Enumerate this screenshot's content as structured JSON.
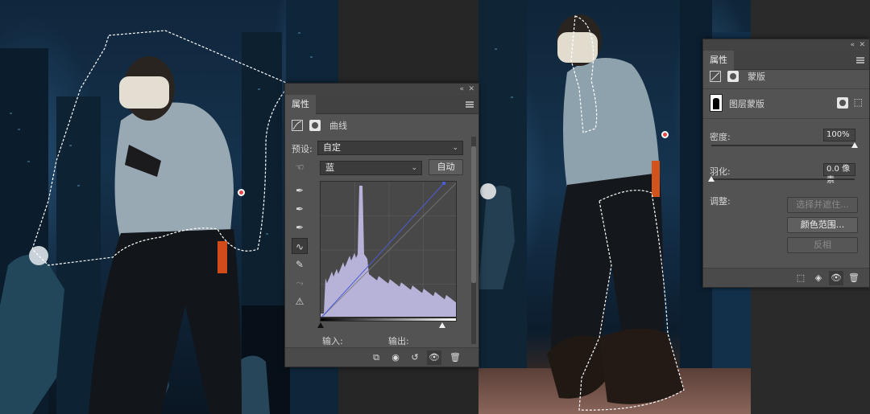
{
  "curves_panel": {
    "tab_label": "属性",
    "title_label": "曲线",
    "preset_label": "预设:",
    "preset_value": "自定",
    "channel_value": "蓝",
    "auto_button": "自动",
    "input_label": "输入:",
    "output_label": "输出:",
    "icons": {
      "adjustment_type": "curves-adjustment-icon",
      "mask": "layer-mask-icon",
      "target_adjust": "target-adjust-hand-icon",
      "black_point": "black-point-eyedropper-icon",
      "gray_point": "gray-point-eyedropper-icon",
      "white_point": "white-point-eyedropper-icon",
      "curve_point": "curve-point-tool-icon",
      "pencil": "pencil-draw-icon",
      "smooth": "smooth-curve-icon",
      "clipping_warning": "clipping-warning-icon",
      "clip_to_layer": "clip-to-layer-icon",
      "view_previous": "view-previous-state-icon",
      "reset": "reset-icon",
      "visibility": "eye-icon",
      "delete": "trash-icon"
    }
  },
  "mask_panel": {
    "tab_label": "属性",
    "title_label": "蒙版",
    "layer_mask_label": "图层蒙版",
    "density_label": "密度:",
    "density_value": "100%",
    "feather_label": "羽化:",
    "feather_value": "0.0 像素",
    "refine_label": "调整:",
    "select_and_mask_button": "选择并遮住...",
    "color_range_button": "颜色范围...",
    "invert_button": "反相",
    "density_percent": 100,
    "feather_fraction": 0
  },
  "histogram": {
    "fill_color": "#b7b2d8",
    "curve_color": "#4a5cd6"
  }
}
